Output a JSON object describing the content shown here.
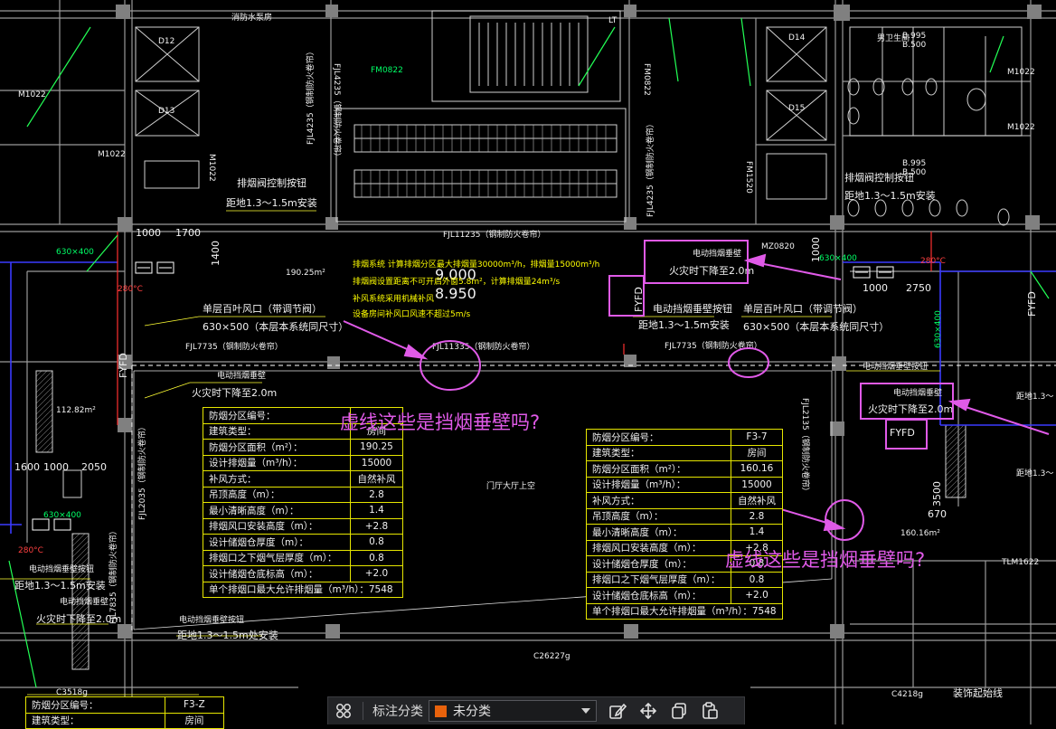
{
  "colors": {
    "background": "#000000",
    "annotation": "#e05ae8",
    "table_border": "#e6e600",
    "category_swatch": "#e8620c",
    "toolbar_bg": "#232427"
  },
  "annotations": {
    "question_1": "虚线这些是挡烟垂壁吗?",
    "question_2": "虚线这些是挡烟垂壁吗?"
  },
  "drawing_text": {
    "room_top_left": "消防水泵房",
    "d12": "D12",
    "d13": "D13",
    "d14": "D14",
    "d15": "D15",
    "m1022": "M1022",
    "fjl_left": "FJL4235（钢制防火卷帘）",
    "fjl_right": "FJL4235（钢制防火卷帘）",
    "fjl_top_mid": "FJL11235（钢制防火卷帘）",
    "fjl_mid": "FJL11335（钢制防火卷帘）",
    "fjl7735_left": "FJL7735（钢制防火卷帘）",
    "fjl7735_right": "FJL7735（钢制防火卷帘）",
    "fjl2035": "FJL2035（钢制防火卷帘）",
    "fjl2135": "FJL2135（钢制防火卷帘）",
    "fjl7835": "FJL7835（钢制防火卷帘）",
    "btn_install_1": "排烟阀控制按钮",
    "btn_height_1": "距地1.3～1.5m安装",
    "btn_install_2": "排烟阀控制按钮",
    "btn_height_2": "距地1.3～1.5m安装",
    "vent_left": "单层百叶风口（带调节阀）",
    "vent_left_size": "630×500（本层本系统同尺寸）",
    "vent_right": "单层百叶风口（带调节阀）",
    "vent_right_size": "630×500（本层本系统同尺寸）",
    "smoke_wall_btn": "电动挡烟垂壁按钮",
    "smoke_wall_btn_h": "距地1.3～1.5m安装",
    "smoke_wall": "电动挡烟垂壁",
    "smoke_wall_drop": "火灾时下降至2.0m",
    "smoke_wall_2": "电动挡烟垂壁",
    "smoke_wall_drop_2": "火灾时下降至2.0m",
    "smoke_wall_3": "电动挡烟垂壁",
    "smoke_wall_drop_3": "火灾时下降至2.0m",
    "smoke_wall_btn_r": "电动挡烟垂壁按钮",
    "smoke_wall_btn_left": "电动挡烟垂壁按钮",
    "smoke_wall_btn_left_h": "距地1.3～1.5m安装",
    "smoke_wall_left": "电动挡烟垂壁",
    "smoke_wall_left_drop": "火灾时下降至2.0m",
    "btn_bottom": "电动挡烟垂壁按钮",
    "btn_bottom_h": "距地1.3～1.5m处安装",
    "elev_1": "9.000",
    "elev_2": "8.950",
    "area_1": "190.25m²",
    "area_2": "112.82m²",
    "area_3": "160.16m²",
    "dim_1000": "1000",
    "dim_1700": "1700",
    "dim_1400": "1400",
    "dim_2750": "2750",
    "dim_1600": "1600",
    "dim_1000b": "1000",
    "dim_2050": "2050",
    "dim_3500": "3500",
    "dim_670": "670",
    "dim_630x400_a": "630×400",
    "dim_630x400_b": "630×400",
    "dim_630x400_c": "630×400",
    "temp_1": "280°C",
    "temp_2": "280°C",
    "temp_3": "280°C",
    "fyfd": "FYFD",
    "fyfd_2": "FYFD",
    "fyfd_3": "FYFD",
    "c26227": "C26227g",
    "c3518": "C3518g",
    "c4218": "C4218g",
    "tlm1622": "TLM1622",
    "decor_line": "装饰起始线",
    "note_yellow_1": "排烟系统 计算排烟分区最大排烟量30000m³/h，排烟量15000m³/h",
    "note_yellow_2": "排烟阀设置距离不可开启外窗5.8m²，计算排烟量24m³/s",
    "note_yellow_3": "补风系统采用机械补风",
    "note_yellow_4": "设备房间补风口风速不超过5m/s",
    "b995_1": "B.995",
    "b500_1": "B.500",
    "b995_2": "B.995",
    "b500_2": "B.500",
    "m1022_r": "M1022",
    "room_r1": "男卫生间",
    "mz0820": "MZ0820",
    "fm1520": "FM1520",
    "fm0822": "FM0822",
    "lt": "LT",
    "door_hall": "门厅大厅上空",
    "btn_right_h": "距地1.3～",
    "btn_right_h2": "距地1.3～1.5m"
  },
  "table_left": {
    "rows": [
      {
        "label": "防烟分区编号：",
        "value": ""
      },
      {
        "label": "建筑类型：",
        "value": "房间"
      },
      {
        "label": "防烟分区面积（m²）：",
        "value": "190.25"
      },
      {
        "label": "设计排烟量（m³/h）：",
        "value": "15000"
      },
      {
        "label": "补风方式：",
        "value": "自然补风"
      },
      {
        "label": "吊顶高度（m）：",
        "value": "2.8"
      },
      {
        "label": "最小清晰高度（m）：",
        "value": "1.4"
      },
      {
        "label": "排烟风口安装高度（m）：",
        "value": "+2.8"
      },
      {
        "label": "设计储烟仓厚度（m）：",
        "value": "0.8"
      },
      {
        "label": "排烟口之下烟气层厚度（m）：",
        "value": "0.8"
      },
      {
        "label": "设计储烟仓底标高（m）：",
        "value": "+2.0"
      },
      {
        "label": "单个排烟口最大允许排烟量（m³/h）：7548",
        "value": ""
      }
    ]
  },
  "table_right": {
    "rows": [
      {
        "label": "防烟分区编号：",
        "value": "F3-7"
      },
      {
        "label": "建筑类型：",
        "value": "房间"
      },
      {
        "label": "防烟分区面积（m²）：",
        "value": "160.16"
      },
      {
        "label": "设计排烟量（m³/h）：",
        "value": "15000"
      },
      {
        "label": "补风方式：",
        "value": "自然补风"
      },
      {
        "label": "吊顶高度（m）：",
        "value": "2.8"
      },
      {
        "label": "最小清晰高度（m）：",
        "value": "1.4"
      },
      {
        "label": "排烟风口安装高度（m）：",
        "value": "+2.8"
      },
      {
        "label": "设计储烟仓厚度（m）：",
        "value": "0.8"
      },
      {
        "label": "排烟口之下烟气层厚度（m）：",
        "value": "0.8"
      },
      {
        "label": "设计储烟仓底标高（m）：",
        "value": "+2.0"
      },
      {
        "label": "单个排烟口最大允许排烟量（m³/h）：7548",
        "value": ""
      }
    ]
  },
  "table_bottom_left": {
    "rows": [
      {
        "label": "防烟分区编号：",
        "value": "F3-Z"
      },
      {
        "label": "建筑类型：",
        "value": "房间"
      }
    ]
  },
  "toolbar": {
    "category_label": "标注分类",
    "category_value": "未分类",
    "icons": [
      "categories-icon",
      "edit-icon",
      "move-icon",
      "copy-icon",
      "paste-icon"
    ]
  }
}
